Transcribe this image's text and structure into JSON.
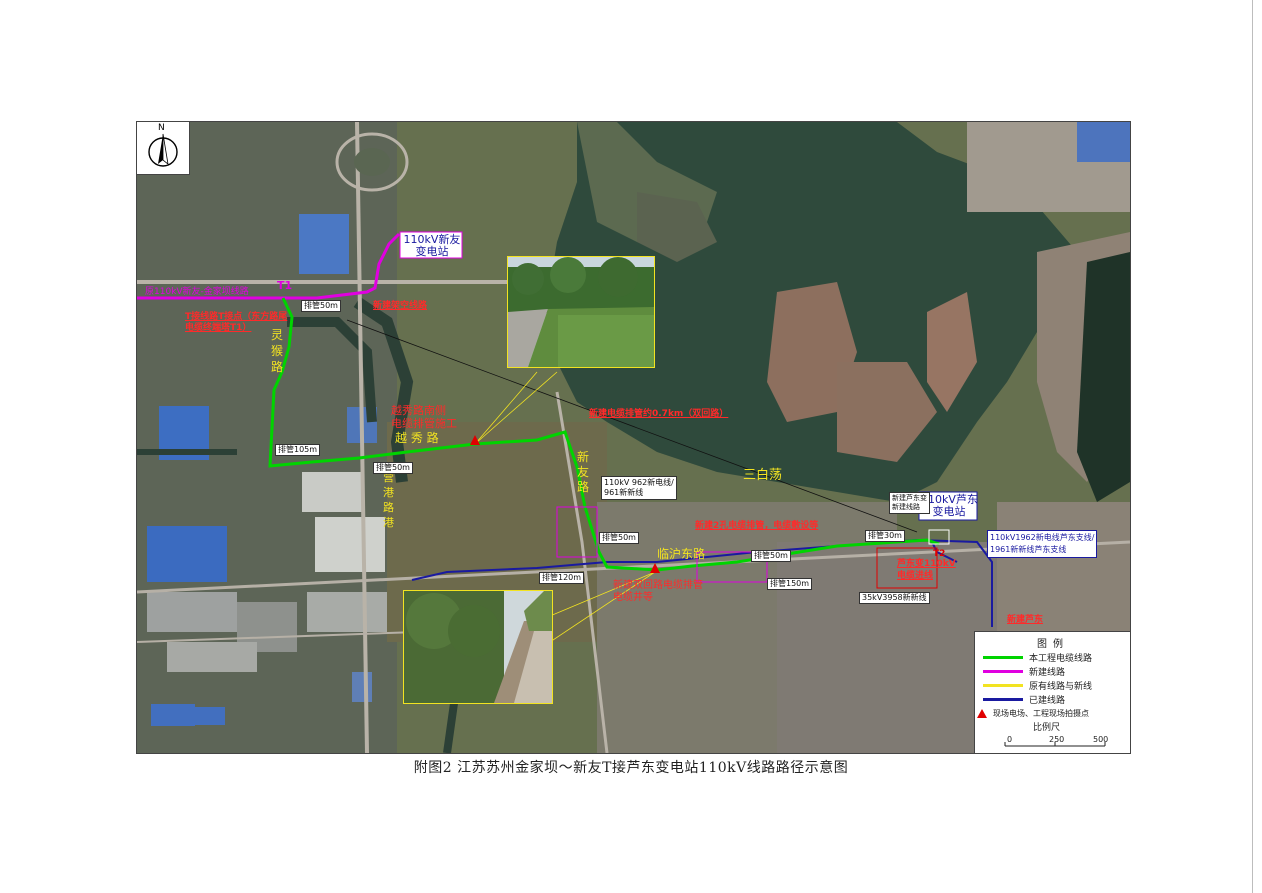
{
  "caption": "附图2  江苏苏州金家坝～新友T接芦东变电站110kV线路路径示意图",
  "compass": {
    "north_label": "N"
  },
  "substations": {
    "xinyou": [
      "110kV新友",
      "变电站"
    ],
    "ludong": [
      "110kV芦东",
      "变电站"
    ]
  },
  "roads": {
    "lingshi": [
      "灵",
      "猴",
      "路"
    ],
    "yuexiu": "越 秀 路",
    "xinyou_rd": [
      "新",
      "友",
      "路"
    ],
    "linhu_east": "临沪东路",
    "yingshan": [
      "营",
      "港",
      "路",
      "港"
    ]
  },
  "water": {
    "sanbaidang": "三白荡"
  },
  "segment_labels": {
    "t1": "T1",
    "t2": "T2",
    "pipe50_a": "排管50m",
    "pipe105": "排管105m",
    "pipe50_b": "排管50m",
    "pipe50_c": "排管50m",
    "pipe150": "排管150m",
    "pipe50_d": "排管50m",
    "pipe120": "排管120m",
    "pipe30": "排管30m"
  },
  "info_boxes": {
    "line_962_top": [
      "110kV 962新电线/",
      "961新新线"
    ],
    "line_1962": [
      "110kV1962新电线芦东支线/",
      "1961新新线芦东支线"
    ],
    "line_35kv": "35kV3958新新线",
    "upper_right_small": [
      "新建芦东变",
      "新建线路"
    ]
  },
  "red_notes": {
    "existing_line": "原110kV新友-金家坝线路",
    "t1_note": [
      "T接线路T接点（东方路尾",
      "电缆终端塔T1）"
    ],
    "west_note": "新建架空线路",
    "yuexiu_note": [
      "越秀路南侧",
      "电缆排管施工"
    ],
    "middle_note": "新建电缆排管约0.7km（双回路）",
    "south_note": [
      "新建双回路电缆排管",
      "电缆井等"
    ],
    "east_note": "新建2孔电缆排管，电缆敷设等",
    "sub_note": [
      "芦东变110kV",
      "电缆进线"
    ],
    "corner_note": "新建芦东"
  },
  "legend": {
    "title": "图例",
    "items": [
      {
        "label": "本工程电缆线路",
        "color": "#00d400",
        "kind": "line"
      },
      {
        "label": "新建线路",
        "color": "#e000e0",
        "kind": "line"
      },
      {
        "label": "原有线路与新线",
        "color": "#f2e321",
        "kind": "line"
      },
      {
        "label": "已建线路",
        "color": "#1a1aa0",
        "kind": "line"
      },
      {
        "label": "现场电场、工程现场拍摄点",
        "color": "#e00000",
        "kind": "triangle"
      }
    ],
    "scale_title": "比例尺",
    "scale_ticks": [
      "0",
      "250",
      "500"
    ]
  }
}
